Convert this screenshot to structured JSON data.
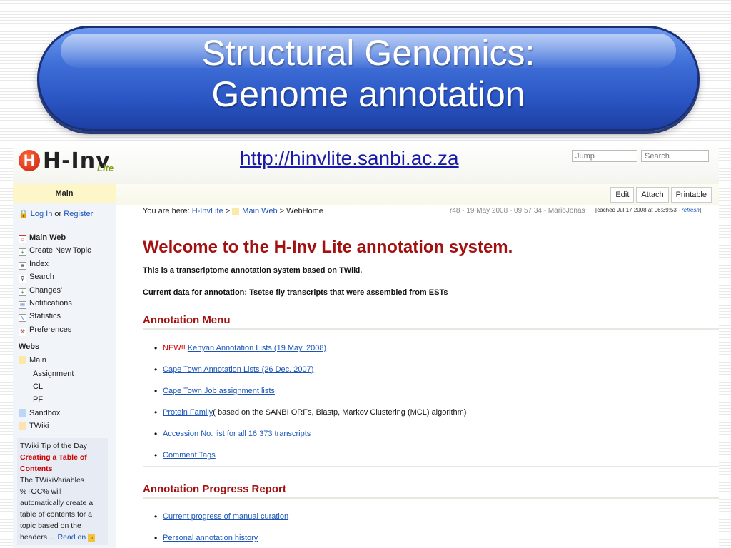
{
  "slide": {
    "title_line1": "Structural Genomics:",
    "title_line2": "Genome annotation"
  },
  "header": {
    "logo_text": "H-Inv",
    "logo_suffix": "Lite",
    "url": "http://hinvlite.sanbi.ac.za",
    "jump_placeholder": "Jump",
    "search_placeholder": "Search"
  },
  "sidebar": {
    "main_label": "Main",
    "login": "Log In",
    "or": " or ",
    "register": "Register",
    "items": [
      {
        "label": "Main Web",
        "icon": "home-icon"
      },
      {
        "label": "Create New Topic",
        "icon": "new-topic-icon"
      },
      {
        "label": "Index",
        "icon": "index-icon"
      },
      {
        "label": "Search",
        "icon": "search-icon"
      },
      {
        "label": "Changes'",
        "icon": "changes-icon"
      },
      {
        "label": "Notifications",
        "icon": "notifications-icon"
      },
      {
        "label": "Statistics",
        "icon": "statistics-icon"
      },
      {
        "label": "Preferences",
        "icon": "preferences-icon"
      }
    ],
    "webs_label": "Webs",
    "webs": [
      {
        "label": "Main",
        "color": "#fde9a6"
      },
      {
        "label": "Assignment",
        "color": "#e6e6e6"
      },
      {
        "label": "CL",
        "color": "#e6e6e6"
      },
      {
        "label": "PF",
        "color": "#e6e6e6"
      },
      {
        "label": "Sandbox",
        "color": "#bcd7f5"
      },
      {
        "label": "TWiki",
        "color": "#fde3b3"
      }
    ],
    "tip": {
      "heading": "TWiki Tip of the Day",
      "title": "Creating a Table of Contents",
      "body": "The TWikiVariables %TOC% will automatically create a table of contents for a topic based on the headers ... ",
      "read_on": "Read on"
    }
  },
  "toolbar": {
    "edit": "Edit",
    "attach": "Attach",
    "printable": "Printable"
  },
  "breadcrumb": {
    "prefix": "You are here: ",
    "crumb1": "H-InvLite",
    "sep1": " > ",
    "crumb2": "Main Web",
    "sep2": " > ",
    "current": "WebHome",
    "revision": "r48 - 19 May 2008 - 09:57:34 - MarioJonas",
    "cached_prefix": "[cached Jul 17 2008 at 06:39:53 - ",
    "refresh": "refresh",
    "cached_suffix": "]"
  },
  "page": {
    "heading": "Welcome to the H-Inv Lite annotation system.",
    "intro": "This is a transcriptome annotation system based on TWiki.",
    "current_data": "Current data for annotation: Tsetse fly transcripts that were assembled from ESTs",
    "menu_heading": "Annotation Menu",
    "menu_new": "NEW!!",
    "menu_items": [
      "Kenyan Annotation Lists (19 May, 2008)",
      "Cape Town Annotation Lists (26 Dec, 2007)",
      "Cape Town Job assignment lists",
      "Protein Family",
      "Accession No. list for all 16,373 transcripts",
      "Comment Tags"
    ],
    "protein_family_note": "( based on the SANBI ORFs, Blastp, Markov Clustering (MCL) algorithm)",
    "report_heading": "Annotation Progress Report",
    "report_items": [
      "Current progress of manual curation",
      "Personal annotation history"
    ]
  }
}
